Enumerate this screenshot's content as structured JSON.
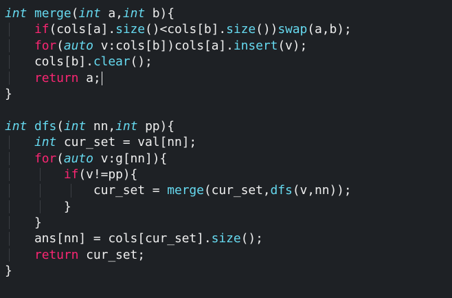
{
  "colors": {
    "background": "#1e2125",
    "plain": "#eeeeee",
    "type_keyword": "#66d9ef",
    "function_name": "#66d9ef",
    "control_keyword": "#f92672",
    "indent_guide": "#3c3f44"
  },
  "editor": {
    "lines": [
      {
        "indent": 0,
        "cursor": false,
        "tokens": [
          {
            "t": "int",
            "k": "type"
          },
          {
            "t": " ",
            "k": "plain"
          },
          {
            "t": "merge",
            "k": "fn"
          },
          {
            "t": "(",
            "k": "plain"
          },
          {
            "t": "int",
            "k": "type"
          },
          {
            "t": " a,",
            "k": "plain"
          },
          {
            "t": "int",
            "k": "type"
          },
          {
            "t": " b){",
            "k": "plain"
          }
        ]
      },
      {
        "indent": 1,
        "cursor": false,
        "tokens": [
          {
            "t": "    ",
            "k": "plain"
          },
          {
            "t": "if",
            "k": "ctrl"
          },
          {
            "t": "(cols[a].",
            "k": "plain"
          },
          {
            "t": "size",
            "k": "fn"
          },
          {
            "t": "()<cols[b].",
            "k": "plain"
          },
          {
            "t": "size",
            "k": "fn"
          },
          {
            "t": "())",
            "k": "plain"
          },
          {
            "t": "swap",
            "k": "fn"
          },
          {
            "t": "(a,b);",
            "k": "plain"
          }
        ]
      },
      {
        "indent": 1,
        "cursor": false,
        "tokens": [
          {
            "t": "    ",
            "k": "plain"
          },
          {
            "t": "for",
            "k": "ctrl"
          },
          {
            "t": "(",
            "k": "plain"
          },
          {
            "t": "auto",
            "k": "type"
          },
          {
            "t": " v:cols[b])cols[a].",
            "k": "plain"
          },
          {
            "t": "insert",
            "k": "fn"
          },
          {
            "t": "(v);",
            "k": "plain"
          }
        ]
      },
      {
        "indent": 1,
        "cursor": false,
        "tokens": [
          {
            "t": "    cols[b].",
            "k": "plain"
          },
          {
            "t": "clear",
            "k": "fn"
          },
          {
            "t": "();",
            "k": "plain"
          }
        ]
      },
      {
        "indent": 1,
        "cursor": true,
        "tokens": [
          {
            "t": "    ",
            "k": "plain"
          },
          {
            "t": "return",
            "k": "ctrl"
          },
          {
            "t": " a;",
            "k": "plain"
          }
        ]
      },
      {
        "indent": 0,
        "cursor": false,
        "tokens": [
          {
            "t": "}",
            "k": "plain"
          }
        ]
      },
      {
        "indent": 0,
        "cursor": false,
        "tokens": []
      },
      {
        "indent": 0,
        "cursor": false,
        "tokens": [
          {
            "t": "int",
            "k": "type"
          },
          {
            "t": " ",
            "k": "plain"
          },
          {
            "t": "dfs",
            "k": "fn"
          },
          {
            "t": "(",
            "k": "plain"
          },
          {
            "t": "int",
            "k": "type"
          },
          {
            "t": " nn,",
            "k": "plain"
          },
          {
            "t": "int",
            "k": "type"
          },
          {
            "t": " pp){",
            "k": "plain"
          }
        ]
      },
      {
        "indent": 1,
        "cursor": false,
        "tokens": [
          {
            "t": "    ",
            "k": "plain"
          },
          {
            "t": "int",
            "k": "type"
          },
          {
            "t": " cur_set = val[nn];",
            "k": "plain"
          }
        ]
      },
      {
        "indent": 1,
        "cursor": false,
        "tokens": [
          {
            "t": "    ",
            "k": "plain"
          },
          {
            "t": "for",
            "k": "ctrl"
          },
          {
            "t": "(",
            "k": "plain"
          },
          {
            "t": "auto",
            "k": "type"
          },
          {
            "t": " v:g[nn]){",
            "k": "plain"
          }
        ]
      },
      {
        "indent": 2,
        "cursor": false,
        "tokens": [
          {
            "t": "        ",
            "k": "plain"
          },
          {
            "t": "if",
            "k": "ctrl"
          },
          {
            "t": "(v!=pp){",
            "k": "plain"
          }
        ]
      },
      {
        "indent": 3,
        "cursor": false,
        "tokens": [
          {
            "t": "            cur_set = ",
            "k": "plain"
          },
          {
            "t": "merge",
            "k": "fn"
          },
          {
            "t": "(cur_set,",
            "k": "plain"
          },
          {
            "t": "dfs",
            "k": "fn"
          },
          {
            "t": "(v,nn));",
            "k": "plain"
          }
        ]
      },
      {
        "indent": 2,
        "cursor": false,
        "tokens": [
          {
            "t": "        }",
            "k": "plain"
          }
        ]
      },
      {
        "indent": 1,
        "cursor": false,
        "tokens": [
          {
            "t": "    }",
            "k": "plain"
          }
        ]
      },
      {
        "indent": 1,
        "cursor": false,
        "tokens": [
          {
            "t": "    ans[nn] = cols[cur_set].",
            "k": "plain"
          },
          {
            "t": "size",
            "k": "fn"
          },
          {
            "t": "();",
            "k": "plain"
          }
        ]
      },
      {
        "indent": 1,
        "cursor": false,
        "tokens": [
          {
            "t": "    ",
            "k": "plain"
          },
          {
            "t": "return",
            "k": "ctrl"
          },
          {
            "t": " cur_set;",
            "k": "plain"
          }
        ]
      },
      {
        "indent": 0,
        "cursor": false,
        "tokens": [
          {
            "t": "}",
            "k": "plain"
          }
        ]
      }
    ]
  }
}
